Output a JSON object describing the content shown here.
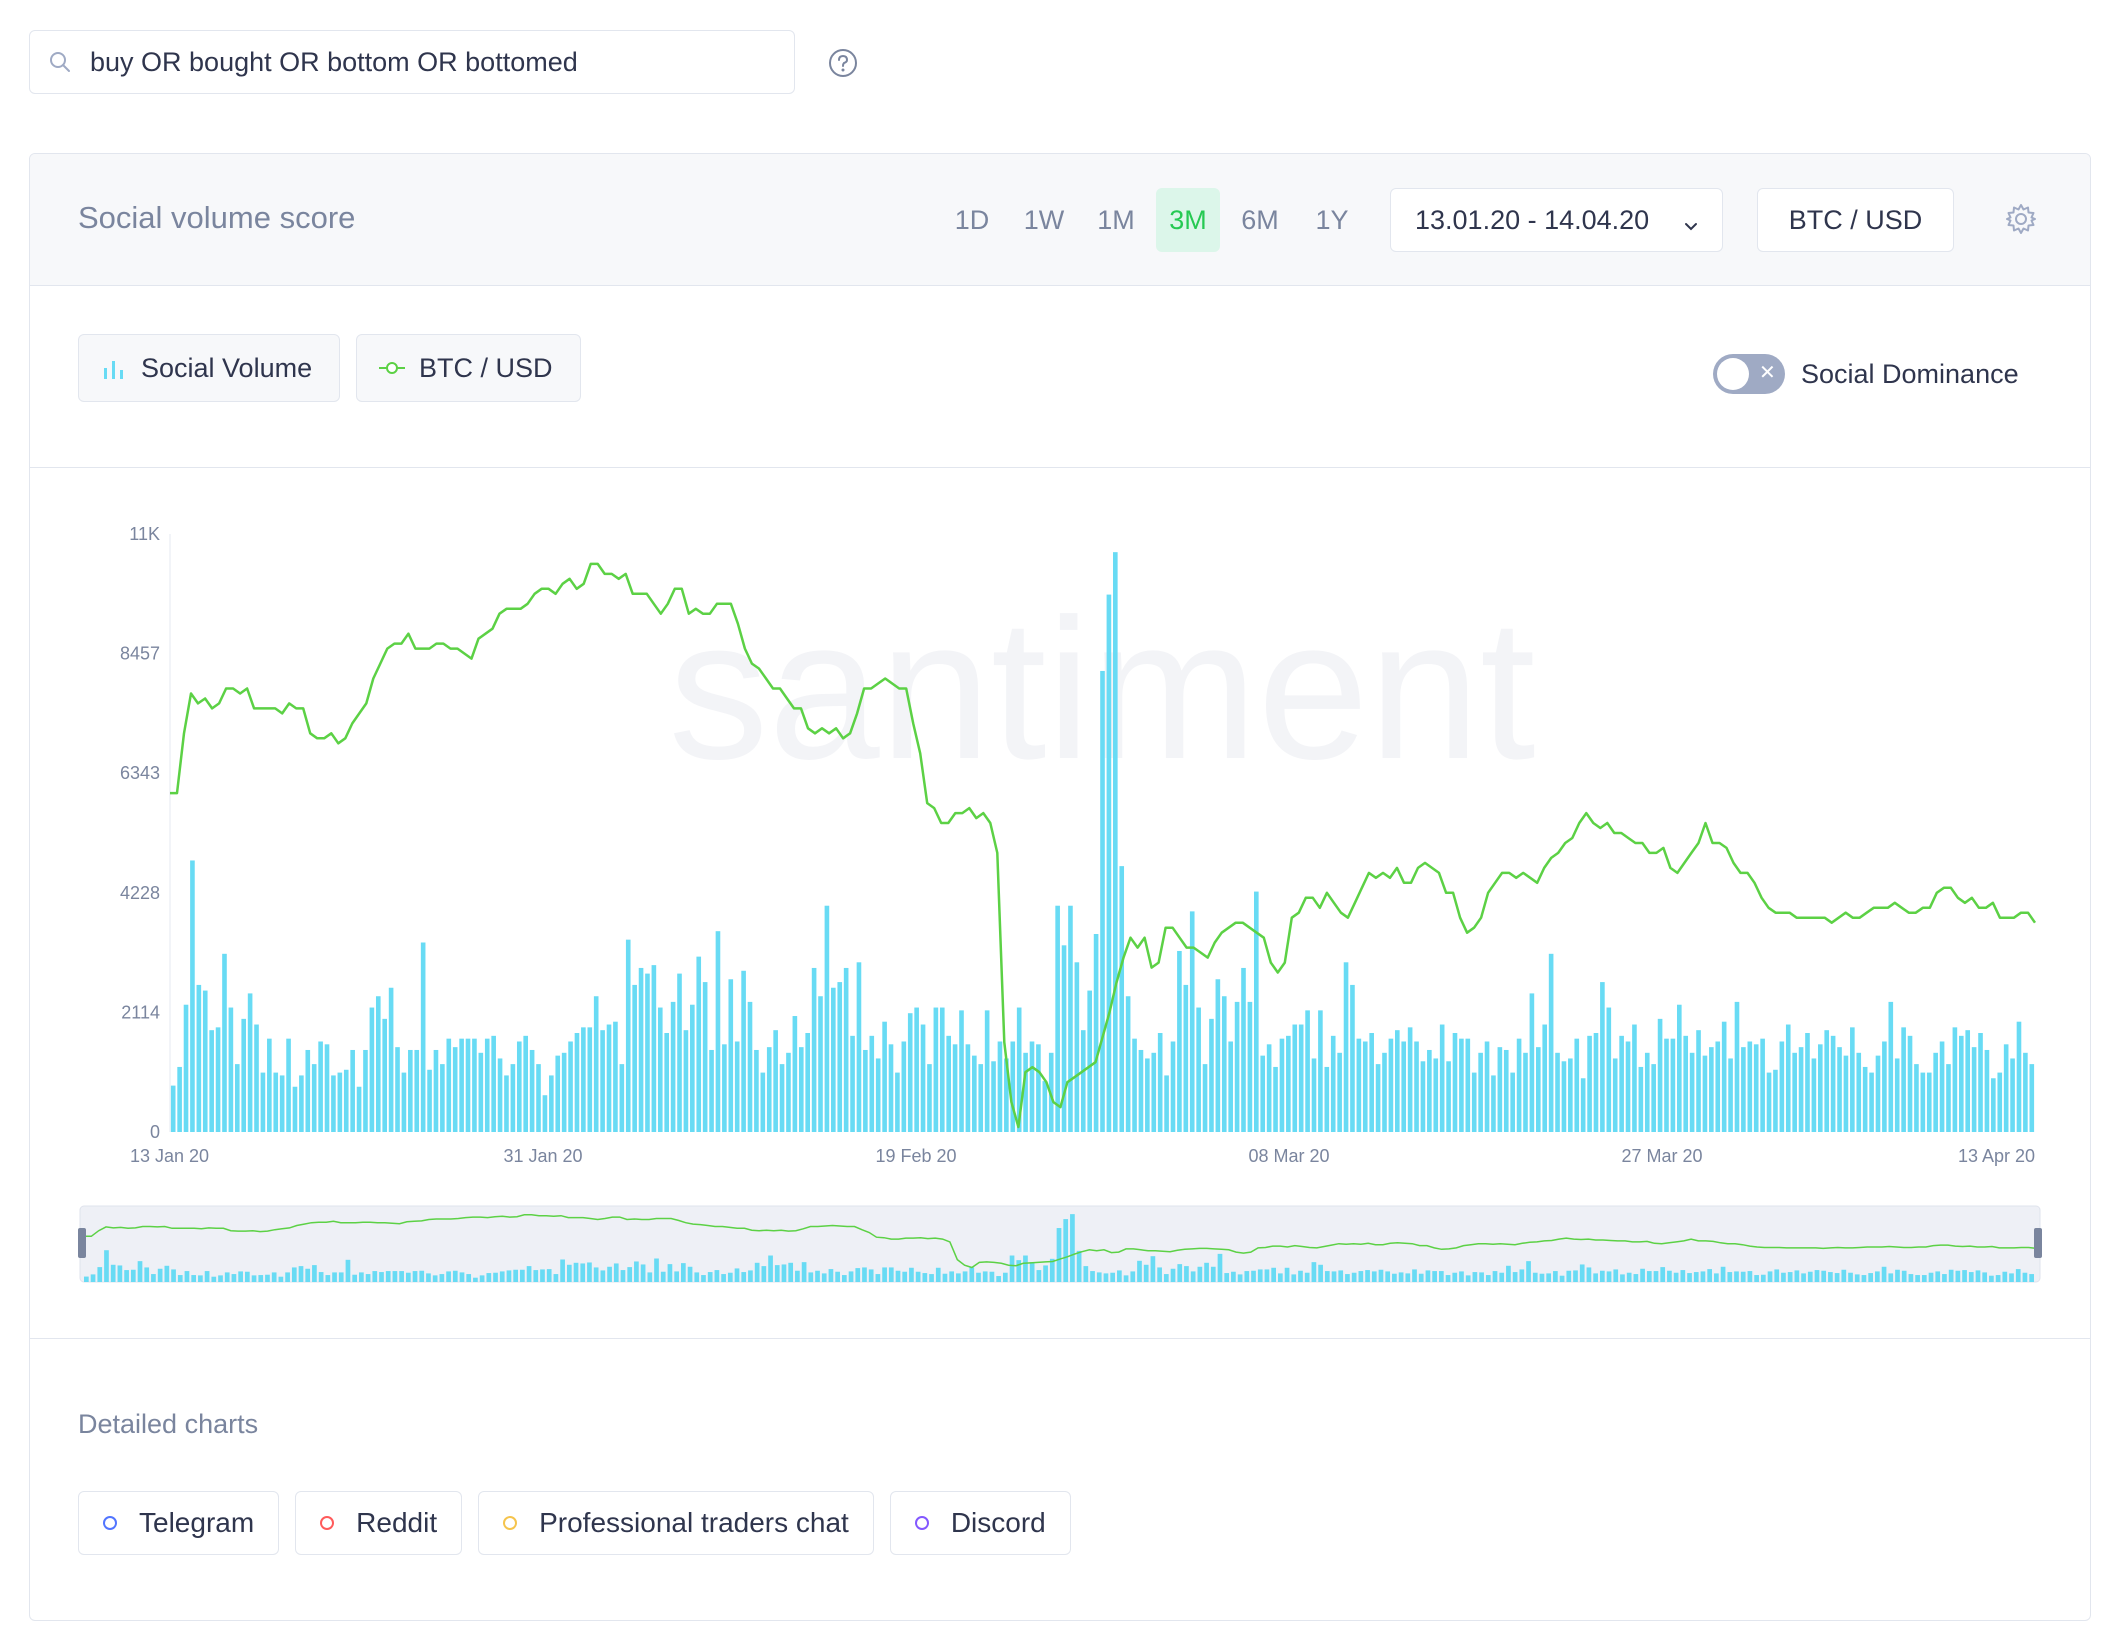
{
  "search": {
    "query": "buy OR bought OR bottom OR bottomed",
    "icon": "search-icon",
    "help_icon": "help-icon"
  },
  "header": {
    "title": "Social volume score",
    "periods": [
      "1D",
      "1W",
      "1M",
      "3M",
      "6M",
      "1Y"
    ],
    "active_period": "3M",
    "date_range": "13.01.20 - 14.04.20",
    "pair": "BTC / USD"
  },
  "metrics": [
    {
      "label": "Social Volume",
      "icon": "bar-chart-icon",
      "color": "#68dbf4"
    },
    {
      "label": "BTC / USD",
      "icon": "line-circle-icon",
      "color": "#5cd145"
    }
  ],
  "toggle": {
    "label": "Social Dominance",
    "on": false
  },
  "watermark": "santiment",
  "chart_data": {
    "type": "bar+line",
    "x_tick_labels": [
      "13 Jan 20",
      "31 Jan 20",
      "19 Feb 20",
      "08 Mar 20",
      "27 Mar 20",
      "13 Apr 20"
    ],
    "y_tick_labels": [
      "11K",
      "8457",
      "6343",
      "4228",
      "2114",
      "0"
    ],
    "ylim": [
      0,
      10571
    ],
    "series": [
      {
        "name": "Social Volume",
        "type": "bar",
        "color": "#68dbf4",
        "values": [
          820,
          1150,
          2250,
          4800,
          2600,
          2500,
          1800,
          1850,
          3150,
          2200,
          1200,
          2000,
          2450,
          1900,
          1050,
          1650,
          1050,
          1000,
          1650,
          800,
          1000,
          1450,
          1200,
          1600,
          1550,
          1000,
          1050,
          1100,
          1450,
          800,
          1450,
          2200,
          2400,
          2000,
          2550,
          1500,
          1050,
          1450,
          1450,
          3350,
          1100,
          1450,
          1200,
          1650,
          1500,
          1650,
          1650,
          1650,
          1400,
          1650,
          1700,
          1300,
          1000,
          1200,
          1600,
          1700,
          1450,
          1200,
          650,
          1000,
          1350,
          1400,
          1600,
          1750,
          1850,
          1850,
          2400,
          1800,
          1900,
          1950,
          1200,
          3400,
          2600,
          2900,
          2800,
          2950,
          2200,
          1750,
          2300,
          2800,
          1800,
          2250,
          3100,
          2650,
          1450,
          3550,
          1550,
          2700,
          1600,
          2850,
          2300,
          1450,
          1050,
          1500,
          1800,
          1200,
          1400,
          2050,
          1500,
          1750,
          2900,
          2400,
          4000,
          2550,
          2650,
          2900,
          1700,
          3000,
          1450,
          1700,
          1300,
          1950,
          1550,
          1050,
          1600,
          2100,
          2200,
          1900,
          1200,
          2200,
          2200,
          1700,
          1550,
          2150,
          1550,
          1350,
          1200,
          2150,
          1250,
          1600,
          1300,
          1600,
          2200,
          1400,
          1600,
          1550,
          900,
          1400,
          4000,
          3300,
          4000,
          3000,
          1800,
          2500,
          3500,
          8150,
          9500,
          10250,
          4700,
          2400,
          1650,
          1450,
          1300,
          1400,
          1750,
          1000,
          1600,
          3200,
          2600,
          3900,
          2200,
          1200,
          2000,
          2700,
          2400,
          1600,
          2300,
          2900,
          2300,
          4250,
          1350,
          1550,
          1150,
          1650,
          1700,
          1900,
          1900,
          2150,
          1300,
          2150,
          1150,
          1700,
          1400,
          3000,
          2600,
          1650,
          1600,
          1750,
          1200,
          1400,
          1650,
          1800,
          1600,
          1850,
          1600,
          1250,
          1450,
          1300,
          1900,
          1250,
          1750,
          1650,
          1650,
          1050,
          1400,
          1600,
          1000,
          1500,
          1450,
          1050,
          1650,
          1400,
          2450,
          1500,
          1900,
          3150,
          1400,
          1250,
          1300,
          1650,
          950,
          1700,
          1750,
          2650,
          2200,
          1300,
          1700,
          1600,
          1900,
          1150,
          1400,
          1200,
          2000,
          1650,
          1650,
          2250,
          1700,
          1400,
          1800,
          1350,
          1500,
          1600,
          1950,
          1300,
          2300,
          1500,
          1600,
          1550,
          1650,
          1050,
          1100,
          1600,
          1900,
          1400,
          1500,
          1750,
          1300,
          1550,
          1800,
          1700,
          1500,
          1350,
          1850,
          1400,
          1150,
          1050,
          1350,
          1600,
          2300,
          1300,
          1850,
          1700,
          1200,
          1050,
          1050,
          1400,
          1600,
          1200,
          1850,
          1700,
          1800,
          1500,
          1750,
          1450,
          950,
          1050,
          1550,
          1300,
          1950,
          1400,
          1200
        ]
      },
      {
        "name": "BTC / USD",
        "type": "line",
        "color": "#5cd145",
        "values": [
          8100,
          8100,
          8700,
          9100,
          9000,
          9050,
          8950,
          9000,
          9150,
          9150,
          9100,
          9150,
          8950,
          8950,
          8950,
          8950,
          8900,
          9000,
          8950,
          8950,
          8700,
          8650,
          8650,
          8700,
          8600,
          8650,
          8800,
          8900,
          9000,
          9250,
          9400,
          9550,
          9600,
          9600,
          9700,
          9550,
          9550,
          9550,
          9600,
          9600,
          9550,
          9550,
          9500,
          9450,
          9650,
          9700,
          9750,
          9900,
          9950,
          9950,
          9950,
          10000,
          10100,
          10150,
          10150,
          10100,
          10200,
          10250,
          10150,
          10200,
          10400,
          10400,
          10300,
          10300,
          10250,
          10300,
          10100,
          10100,
          10100,
          10000,
          9900,
          10000,
          10150,
          10150,
          9900,
          9950,
          9900,
          9900,
          10000,
          10000,
          10000,
          9800,
          9550,
          9400,
          9350,
          9250,
          9150,
          9150,
          9050,
          8950,
          8950,
          8750,
          8700,
          8750,
          8700,
          8750,
          8650,
          8700,
          8900,
          9150,
          9150,
          9200,
          9250,
          9200,
          9150,
          9150,
          8800,
          8500,
          8000,
          7950,
          7800,
          7800,
          7900,
          7900,
          7950,
          7850,
          7900,
          7800,
          7500,
          5600,
          5000,
          4750,
          5300,
          5350,
          5300,
          5200,
          5000,
          4950,
          5200,
          5250,
          5300,
          5350,
          5400,
          5650,
          5900,
          6200,
          6450,
          6650,
          6550,
          6650,
          6350,
          6400,
          6750,
          6750,
          6650,
          6550,
          6550,
          6500,
          6450,
          6600,
          6700,
          6750,
          6800,
          6800,
          6750,
          6700,
          6650,
          6400,
          6300,
          6400,
          6850,
          6900,
          7050,
          7050,
          6950,
          7100,
          7000,
          6900,
          6850,
          7000,
          7150,
          7300,
          7250,
          7300,
          7250,
          7350,
          7200,
          7200,
          7350,
          7400,
          7350,
          7300,
          7100,
          7100,
          6850,
          6700,
          6750,
          6850,
          7100,
          7200,
          7300,
          7300,
          7250,
          7300,
          7250,
          7200,
          7350,
          7450,
          7500,
          7600,
          7650,
          7800,
          7900,
          7800,
          7750,
          7800,
          7700,
          7700,
          7650,
          7600,
          7600,
          7500,
          7500,
          7550,
          7350,
          7300,
          7400,
          7500,
          7600,
          7800,
          7600,
          7600,
          7550,
          7400,
          7300,
          7300,
          7200,
          7050,
          6950,
          6900,
          6900,
          6900,
          6850,
          6850,
          6850,
          6850,
          6850,
          6800,
          6850,
          6900,
          6850,
          6850,
          6900,
          6950,
          6950,
          6950,
          7000,
          6950,
          6900,
          6900,
          6950,
          6950,
          7100,
          7150,
          7150,
          7050,
          7000,
          7050,
          6950,
          6950,
          7000,
          6850,
          6850,
          6850,
          6900,
          6900,
          6800
        ]
      }
    ],
    "price_range": [
      4700,
      10700
    ],
    "grid": false
  },
  "detailed": {
    "title": "Detailed charts",
    "chips": [
      {
        "label": "Telegram",
        "color": "#5275ff"
      },
      {
        "label": "Reddit",
        "color": "#ff5b5b"
      },
      {
        "label": "Professional traders chat",
        "color": "#f5c44d"
      },
      {
        "label": "Discord",
        "color": "#8358ff"
      }
    ]
  }
}
